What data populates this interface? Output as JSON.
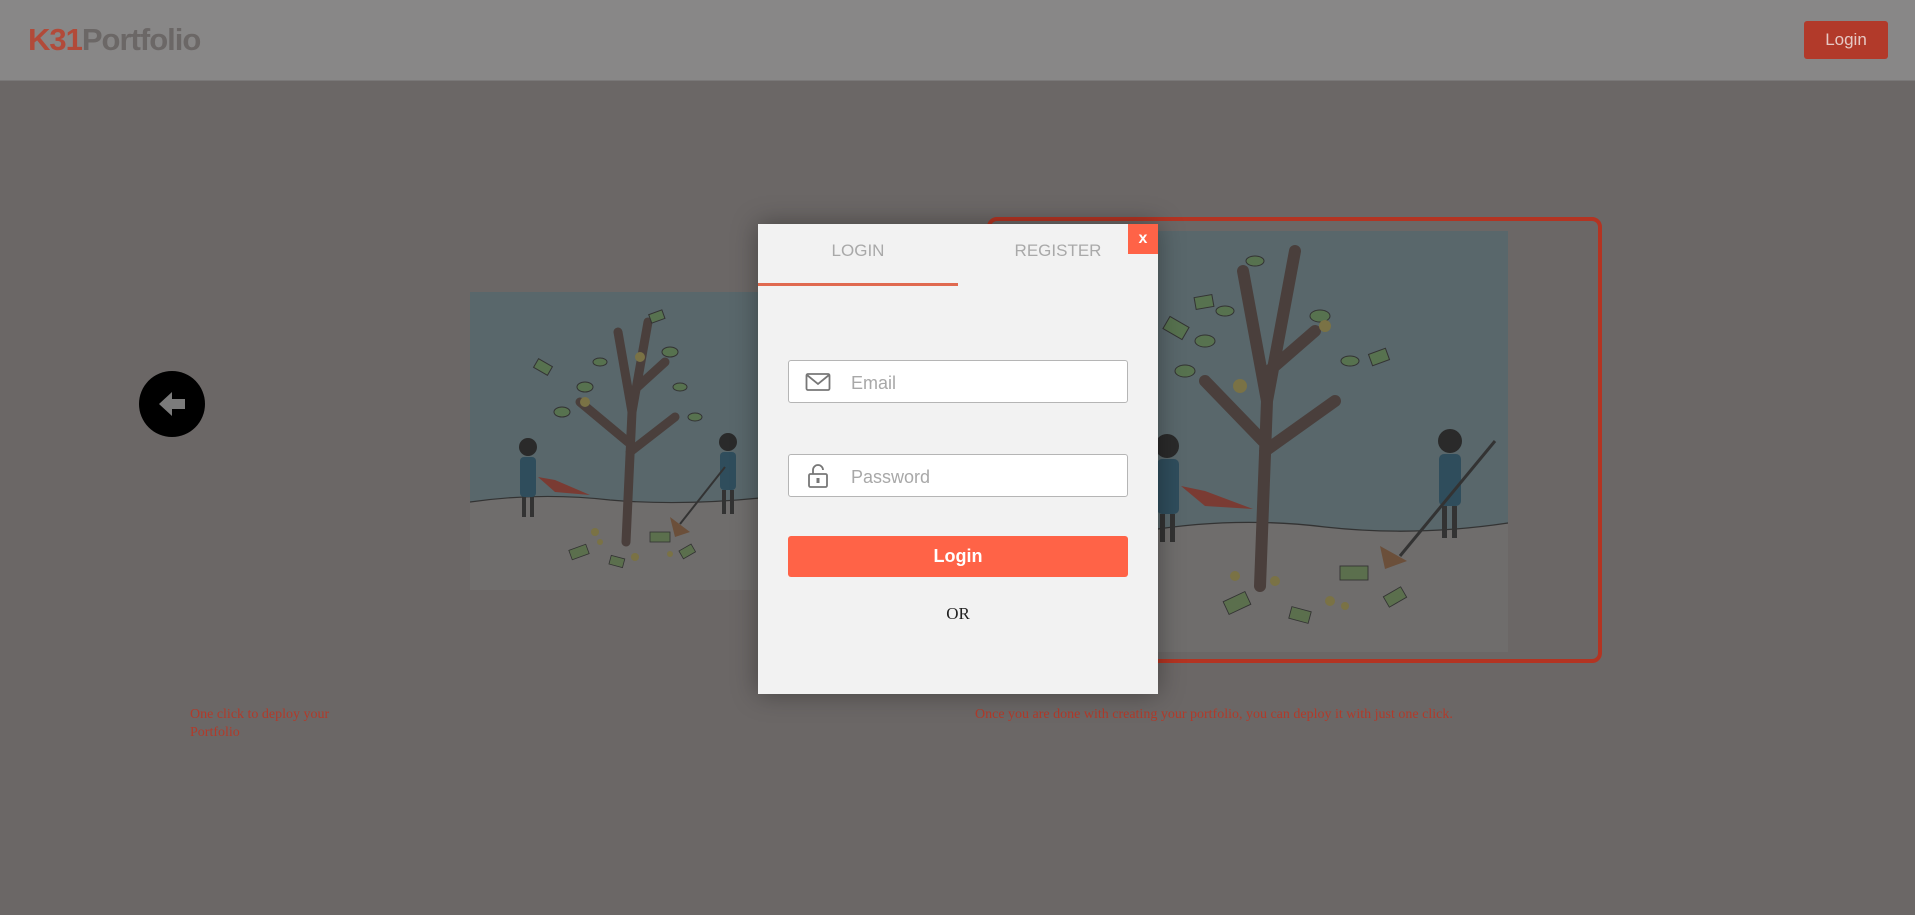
{
  "header": {
    "logo_prefix": "K31",
    "logo_suffix": "Portfolio",
    "login_label": "Login"
  },
  "carousel": {
    "back_icon": "arrow-left-icon",
    "caption_left": "One click to deploy your Portfolio",
    "caption_right": "Once you are done with creating your portfolio, you can deploy it with just one click."
  },
  "modal": {
    "close_label": "x",
    "tabs": [
      {
        "label": "LOGIN",
        "active": true
      },
      {
        "label": "REGISTER",
        "active": false
      }
    ],
    "email": {
      "placeholder": "Email",
      "icon": "mail-icon"
    },
    "password": {
      "placeholder": "Password",
      "icon": "lock-icon"
    },
    "submit_label": "Login",
    "or_label": "OR"
  },
  "colors": {
    "accent": "#ff6347",
    "brand": "#b23a2a"
  }
}
